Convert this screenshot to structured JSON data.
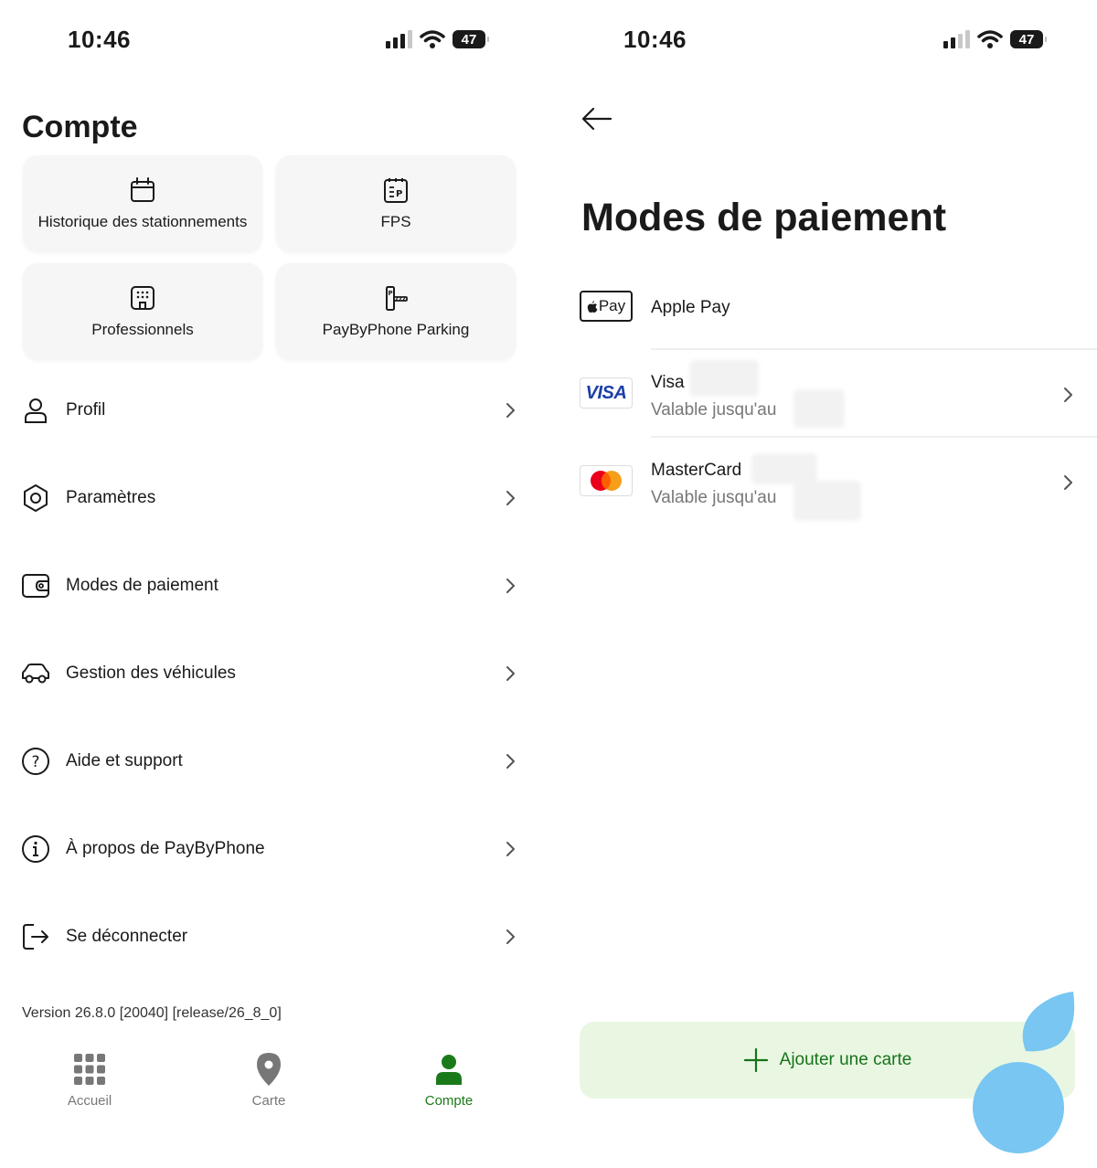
{
  "status_bar": {
    "time": "10:46",
    "battery": "47"
  },
  "account": {
    "title": "Compte",
    "tiles": [
      {
        "label": "Historique des stationnements",
        "icon": "calendar-icon"
      },
      {
        "label": "FPS",
        "icon": "fps-notepad-icon"
      },
      {
        "label": "Professionnels",
        "icon": "building-icon"
      },
      {
        "label": "PayByPhone Parking",
        "icon": "parking-barrier-icon"
      }
    ],
    "menu": [
      {
        "label": "Profil",
        "icon": "person-icon"
      },
      {
        "label": "Paramètres",
        "icon": "hexagon-settings-icon"
      },
      {
        "label": "Modes de paiement",
        "icon": "wallet-icon"
      },
      {
        "label": "Gestion des véhicules",
        "icon": "car-icon"
      },
      {
        "label": "Aide et support",
        "icon": "question-circle-icon"
      },
      {
        "label": "À propos de PayByPhone",
        "icon": "info-circle-icon"
      },
      {
        "label": "Se déconnecter",
        "icon": "logout-icon"
      }
    ],
    "version": "Version 26.8.0 [20040] [release/26_8_0]",
    "nav": {
      "home": "Accueil",
      "map": "Carte",
      "account": "Compte"
    }
  },
  "payment": {
    "title": "Modes de paiement",
    "methods": [
      {
        "name": "Apple Pay",
        "logo_text": "Pay"
      },
      {
        "name": "Visa",
        "logo_text": "VISA",
        "validity": "Valable jusqu'au"
      },
      {
        "name": "MasterCard",
        "validity": "Valable jusqu'au"
      }
    ],
    "add_button": "Ajouter une carte"
  },
  "colors": {
    "accent_green": "#16731a",
    "add_button_bg": "#e9f7e2",
    "visa_blue": "#1a3fa8",
    "mastercard_red": "#eb001b",
    "mastercard_orange": "#f79e1b",
    "blob_blue": "#78c6f1"
  }
}
